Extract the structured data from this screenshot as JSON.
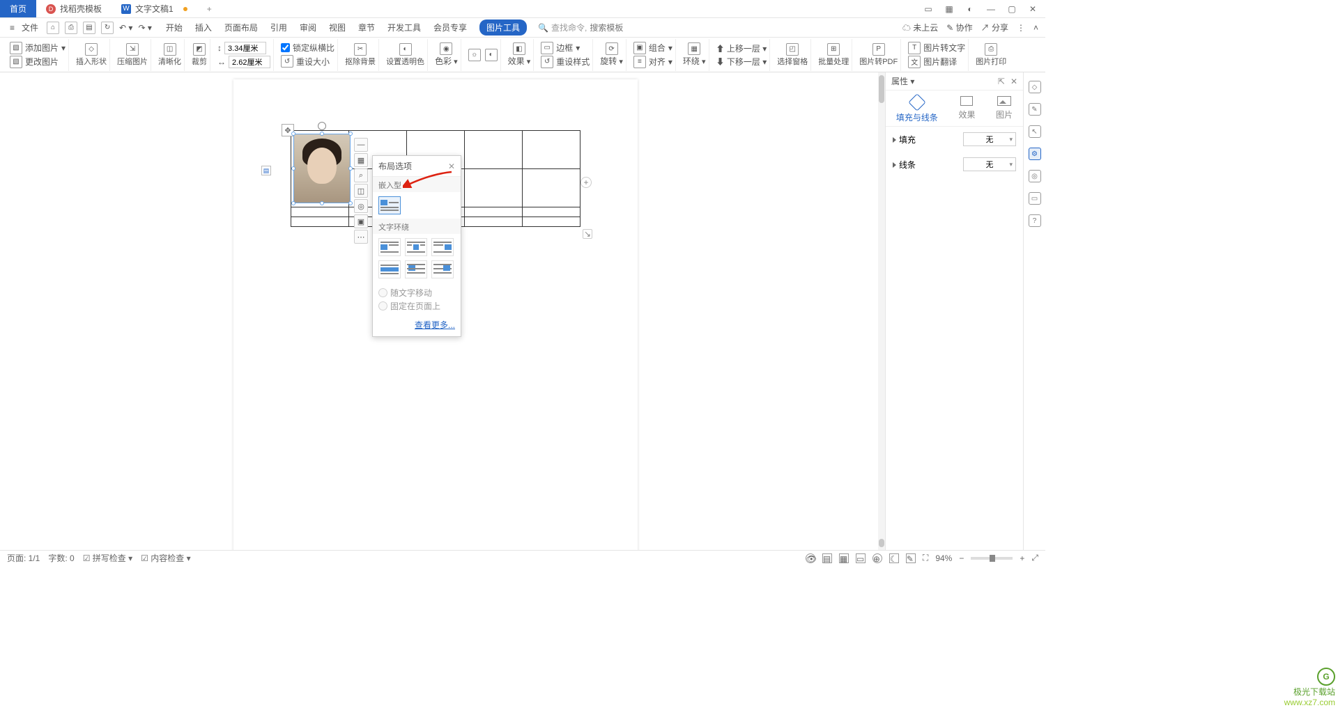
{
  "titlebar": {
    "tab_home": "首页",
    "tab2": "找稻壳模板",
    "tab3": "文字文稿1",
    "new_tab": "+"
  },
  "menubar": {
    "file": "文件",
    "tabs": [
      "开始",
      "插入",
      "页面布局",
      "引用",
      "审阅",
      "视图",
      "章节",
      "开发工具",
      "会员专享"
    ],
    "active_tool": "图片工具",
    "search_hint": "查找命令,",
    "search_placeholder": "搜索模板",
    "cloud": "未上云",
    "collab": "协作",
    "share": "分享"
  },
  "ribbon": {
    "add_image": "添加图片",
    "change_image": "更改图片",
    "insert_shape": "插入形状",
    "compress": "压缩图片",
    "sharpen": "清晰化",
    "crop": "裁剪",
    "width": "3.34厘米",
    "height": "2.62厘米",
    "lock_ratio": "锁定纵横比",
    "reset_size": "重设大小",
    "remove_bg": "抠除背景",
    "set_transparency": "设置透明色",
    "color": "色彩",
    "effect": "效果",
    "reset_style": "重设样式",
    "border": "边框",
    "rotate": "旋转",
    "combine": "组合",
    "align": "对齐",
    "wrap": "环绕",
    "bring_front": "上移一层",
    "send_back": "下移一层",
    "sel_pane": "选择窗格",
    "batch": "批量处理",
    "to_pdf": "图片转PDF",
    "to_text": "图片转文字",
    "translate": "图片翻译",
    "print": "图片打印"
  },
  "img_toolbar": {
    "minus": "—",
    "layout": "▦",
    "zoom": "⌕",
    "crop": "◫",
    "idea": "◎",
    "coord": "▣",
    "more": "⋯"
  },
  "popup": {
    "title": "布局选项",
    "section1": "嵌入型",
    "section2": "文字环绕",
    "radio1": "随文字移动",
    "radio2": "固定在页面上",
    "more": "查看更多..."
  },
  "sidepanel": {
    "title": "属性",
    "tab1": "填充与线条",
    "tab2": "效果",
    "tab3": "图片",
    "row_fill": "填充",
    "row_line": "线条",
    "none": "无"
  },
  "statusbar": {
    "page": "页面: 1/1",
    "chars": "字数: 0",
    "spell": "拼写检查",
    "content": "内容检查",
    "zoom": "94%"
  },
  "watermark": {
    "line1": "极光下载站",
    "line2": "www.xz7.com"
  }
}
